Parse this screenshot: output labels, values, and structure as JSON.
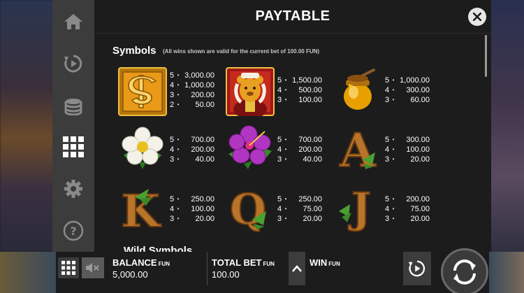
{
  "panel": {
    "title": "PAYTABLE",
    "section_title": "Symbols",
    "section_note": "(All wins shown are valid for the current bet of 100.00 FUN)",
    "next_section_title": "Wild Symbols"
  },
  "sidebar": {
    "items": [
      {
        "icon": "home-icon"
      },
      {
        "icon": "autoplay-icon"
      },
      {
        "icon": "coins-stack-icon"
      },
      {
        "icon": "grid-menu-icon",
        "active": true
      },
      {
        "icon": "gear-icon"
      },
      {
        "icon": "help-icon"
      }
    ]
  },
  "symbols": [
    {
      "name": "dollar",
      "pays": [
        {
          "count": "5",
          "value": "3,000.00"
        },
        {
          "count": "4",
          "value": "1,000.00"
        },
        {
          "count": "3",
          "value": "200.00"
        },
        {
          "count": "2",
          "value": "50.00"
        }
      ]
    },
    {
      "name": "bear-king",
      "pays": [
        {
          "count": "5",
          "value": "1,500.00"
        },
        {
          "count": "4",
          "value": "500.00"
        },
        {
          "count": "3",
          "value": "100.00"
        }
      ]
    },
    {
      "name": "honey-pot",
      "pays": [
        {
          "count": "5",
          "value": "1,000.00"
        },
        {
          "count": "4",
          "value": "300.00"
        },
        {
          "count": "3",
          "value": "60.00"
        }
      ]
    },
    {
      "name": "white-flower",
      "pays": [
        {
          "count": "5",
          "value": "700.00"
        },
        {
          "count": "4",
          "value": "200.00"
        },
        {
          "count": "3",
          "value": "40.00"
        }
      ]
    },
    {
      "name": "purple-flower",
      "pays": [
        {
          "count": "5",
          "value": "700.00"
        },
        {
          "count": "4",
          "value": "200.00"
        },
        {
          "count": "3",
          "value": "40.00"
        }
      ]
    },
    {
      "name": "letter-a",
      "pays": [
        {
          "count": "5",
          "value": "300.00"
        },
        {
          "count": "4",
          "value": "100.00"
        },
        {
          "count": "3",
          "value": "20.00"
        }
      ]
    },
    {
      "name": "letter-k",
      "pays": [
        {
          "count": "5",
          "value": "250.00"
        },
        {
          "count": "4",
          "value": "100.00"
        },
        {
          "count": "3",
          "value": "20.00"
        }
      ]
    },
    {
      "name": "letter-q",
      "pays": [
        {
          "count": "5",
          "value": "250.00"
        },
        {
          "count": "4",
          "value": "75.00"
        },
        {
          "count": "3",
          "value": "20.00"
        }
      ]
    },
    {
      "name": "letter-j",
      "pays": [
        {
          "count": "5",
          "value": "200.00"
        },
        {
          "count": "4",
          "value": "75.00"
        },
        {
          "count": "3",
          "value": "20.00"
        }
      ]
    }
  ],
  "letters": {
    "a": "A",
    "k": "K",
    "q": "Q",
    "j": "J"
  },
  "bottombar": {
    "balance_label": "BALANCE",
    "balance_unit": "FUN",
    "balance_value": "5,000.00",
    "bet_label": "TOTAL BET",
    "bet_unit": "FUN",
    "bet_value": "100.00",
    "win_label": "WIN",
    "win_unit": "FUN"
  },
  "colors": {
    "accent_gold": "#e8a820",
    "panel_bg": "#1c1c1c",
    "sidebar_bg": "#3c3c3c"
  }
}
